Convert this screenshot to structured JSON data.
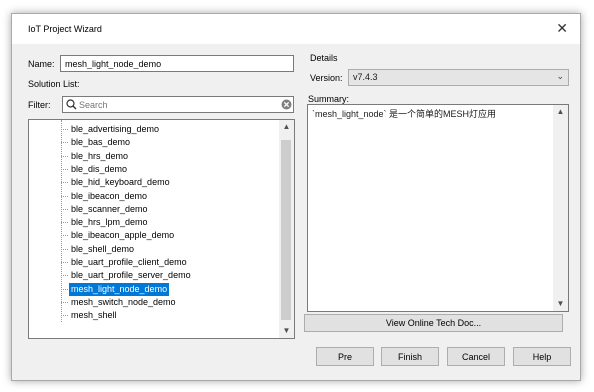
{
  "window": {
    "title": "IoT Project Wizard",
    "close_glyph": "✕"
  },
  "name_field": {
    "label": "Name:",
    "value": "mesh_light_node_demo"
  },
  "solution_list": {
    "label": "Solution List:",
    "filter_label": "Filter:",
    "search_placeholder": "Search",
    "items": [
      "ble_advertising_demo",
      "ble_bas_demo",
      "ble_hrs_demo",
      "ble_dis_demo",
      "ble_hid_keyboard_demo",
      "ble_ibeacon_demo",
      "ble_scanner_demo",
      "ble_hrs_lpm_demo",
      "ble_ibeacon_apple_demo",
      "ble_shell_demo",
      "ble_uart_profile_client_demo",
      "ble_uart_profile_server_demo",
      "mesh_light_node_demo",
      "mesh_switch_node_demo",
      "mesh_shell"
    ],
    "selected_item": "mesh_light_node_demo"
  },
  "details": {
    "title": "Details",
    "version_label": "Version:",
    "version_value": "v7.4.3",
    "summary_label": "Summary:",
    "summary_text": "`mesh_light_node` 是一个简单的MESH灯应用"
  },
  "buttons": {
    "view_doc": "View Online Tech Doc...",
    "pre": "Pre",
    "finish": "Finish",
    "cancel": "Cancel",
    "help": "Help"
  },
  "colors": {
    "selection": "#0078d7",
    "dialog_bg": "#f0f0f0"
  }
}
